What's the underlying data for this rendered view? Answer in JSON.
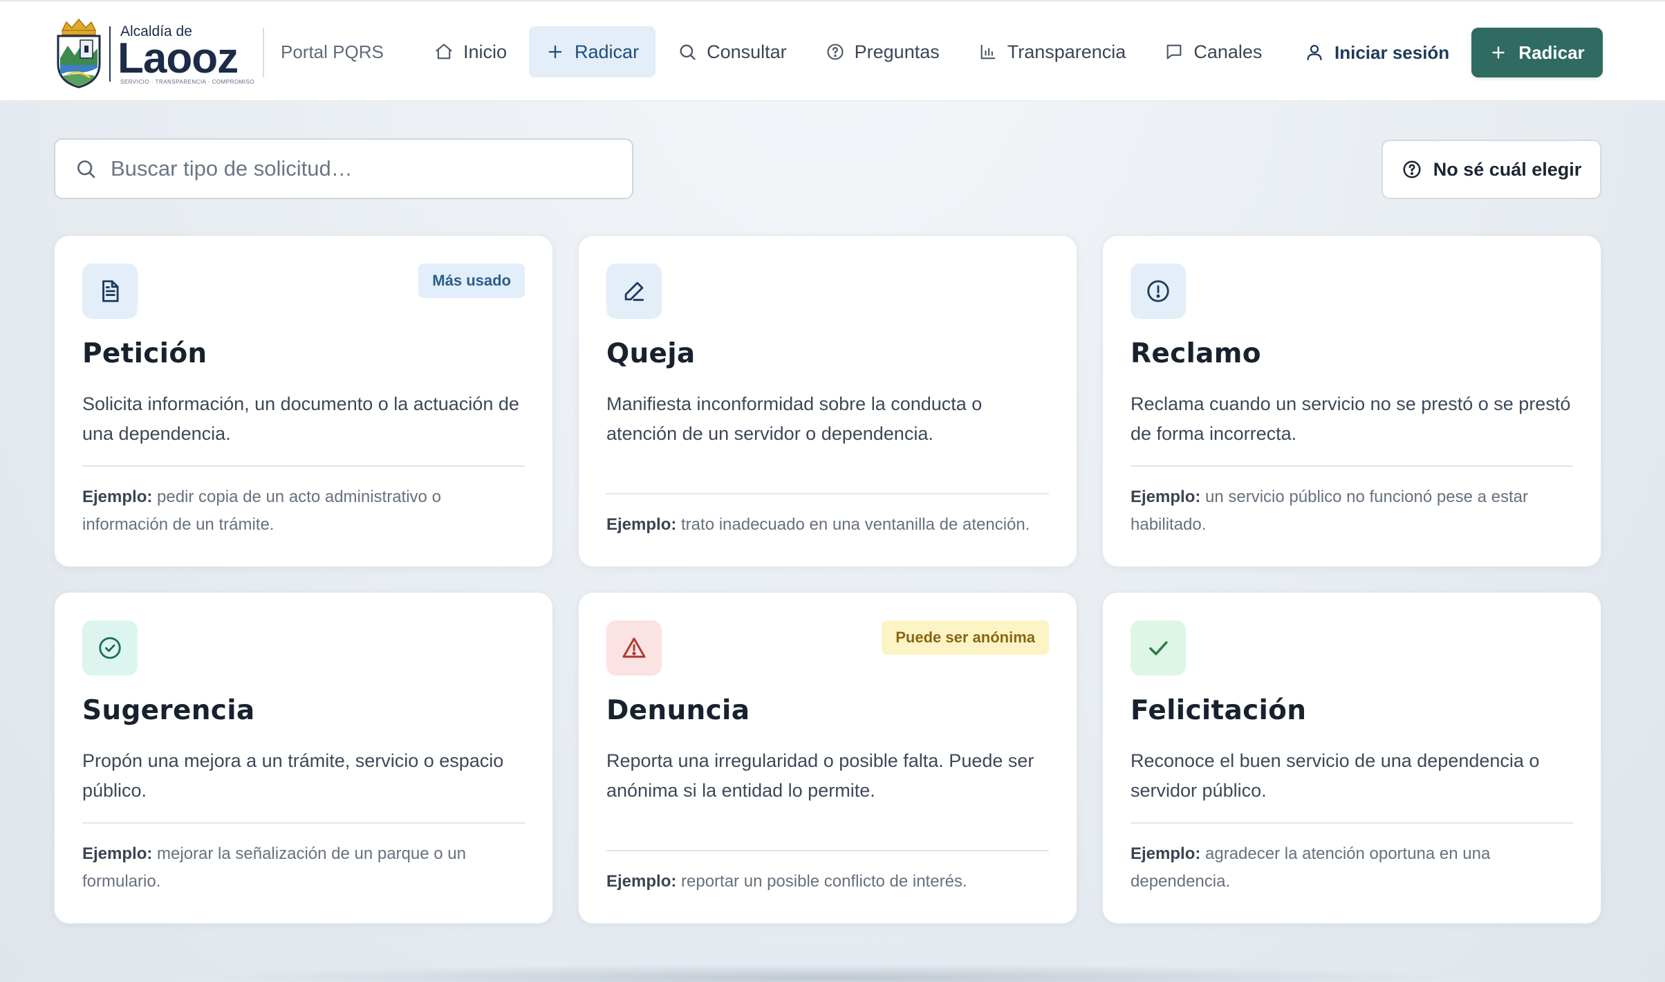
{
  "header": {
    "logo": {
      "top_text": "Alcaldía de",
      "name": "Laooz",
      "tagline": "SERVICIO · TRANSPARENCIA · COMPROMISO"
    },
    "portal_label": "Portal PQRS",
    "nav": [
      {
        "label": "Inicio",
        "icon": "home-icon"
      },
      {
        "label": "Radicar",
        "icon": "plus-icon",
        "active": true
      },
      {
        "label": "Consultar",
        "icon": "search-icon"
      },
      {
        "label": "Preguntas",
        "icon": "help-circle-icon"
      },
      {
        "label": "Transparencia",
        "icon": "bar-chart-icon"
      },
      {
        "label": "Canales",
        "icon": "chat-icon"
      }
    ],
    "login_label": "Iniciar sesión",
    "cta_label": "Radicar",
    "cta_color": "#2f6b60"
  },
  "search": {
    "placeholder": "Buscar tipo de solicitud…",
    "value": ""
  },
  "help_button": {
    "label": "No sé cuál elegir",
    "icon": "help-circle-icon"
  },
  "cards": [
    {
      "title": "Petición",
      "icon": "file-text-icon",
      "icon_bg": "#e3eef9",
      "icon_color": "#1f3a5a",
      "badge": "Más usado",
      "description": "Solicita información, un documento o la actuación de una dependencia.",
      "example_label": "Ejemplo:",
      "example": "pedir copia de un acto administrativo o información de un trámite."
    },
    {
      "title": "Queja",
      "icon": "pen-icon",
      "icon_bg": "#e3eef9",
      "icon_color": "#1f3a5a",
      "badge": "",
      "description": "Manifiesta inconformidad sobre la conducta o atención de un servidor o dependencia.",
      "example_label": "Ejemplo:",
      "example": "trato inadecuado en una ventanilla de atención."
    },
    {
      "title": "Reclamo",
      "icon": "alert-circle-icon",
      "icon_bg": "#e3eef9",
      "icon_color": "#1f3a5a",
      "badge": "",
      "description": "Reclama cuando un servicio no se prestó o se prestó de forma incorrecta.",
      "example_label": "Ejemplo:",
      "example": "un servicio público no funcionó pese a estar habilitado."
    },
    {
      "title": "Sugerencia",
      "icon": "check-circle-icon",
      "icon_bg": "#dcf5ee",
      "icon_color": "#1f6b5a",
      "badge": "",
      "description": "Propón una mejora a un trámite, servicio o espacio público.",
      "example_label": "Ejemplo:",
      "example": "mejorar la señalización de un parque o un formulario."
    },
    {
      "title": "Denuncia",
      "icon": "warning-triangle-icon",
      "icon_bg": "#fbe3e3",
      "icon_color": "#b03a35",
      "badge": "Puede ser anónima",
      "description": "Reporta una irregularidad o posible falta. Puede ser anónima si la entidad lo permite.",
      "example_label": "Ejemplo:",
      "example": "reportar un posible conflicto de interés."
    },
    {
      "title": "Felicitación",
      "icon": "check-icon",
      "icon_bg": "#def6e6",
      "icon_color": "#2d7a4a",
      "badge": "",
      "description": "Reconoce el buen servicio de una dependencia o servidor público.",
      "example_label": "Ejemplo:",
      "example": "agradecer la atención oportuna en una dependencia."
    }
  ]
}
